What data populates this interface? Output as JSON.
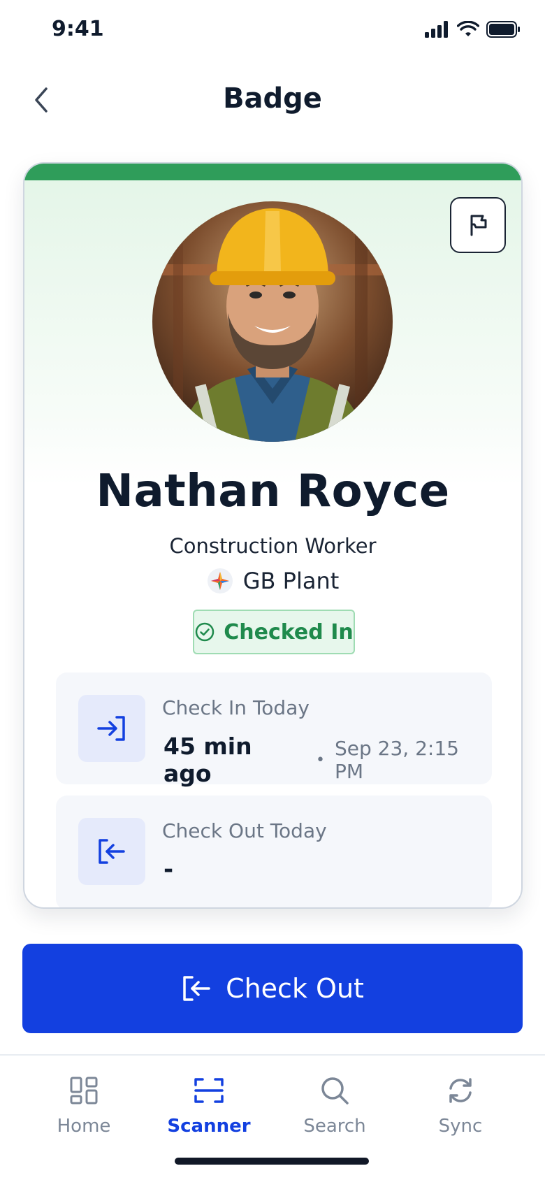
{
  "status_bar": {
    "time": "9:41"
  },
  "header": {
    "title": "Badge"
  },
  "badge": {
    "name": "Nathan Royce",
    "role": "Construction Worker",
    "company": "GB Plant",
    "status": "Checked In",
    "status_color": "#1f8a4c",
    "accent_color": "#2f9d5a"
  },
  "check_in": {
    "label": "Check In Today",
    "relative": "45 min ago",
    "separator": "•",
    "timestamp": "Sep 23, 2:15 PM"
  },
  "check_out": {
    "label": "Check Out Today",
    "value": "-"
  },
  "primary_action": {
    "label": "Check Out",
    "color": "#1340e0"
  },
  "tab_bar": {
    "items": [
      {
        "label": "Home",
        "icon": "grid-icon",
        "active": false
      },
      {
        "label": "Scanner",
        "icon": "scanner-icon",
        "active": true
      },
      {
        "label": "Search",
        "icon": "search-icon",
        "active": false
      },
      {
        "label": "Sync",
        "icon": "sync-icon",
        "active": false
      }
    ]
  }
}
